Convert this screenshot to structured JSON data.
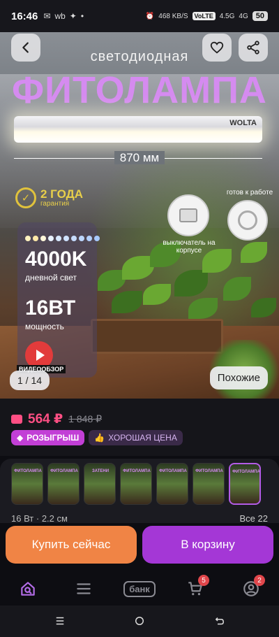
{
  "status_bar": {
    "time": "16:46",
    "network_speed": "468 KB/S",
    "volte": "VoLTE",
    "signal_1": "4.5G",
    "signal_2": "4G",
    "battery": "50"
  },
  "hero": {
    "title_small": "светодиодная",
    "title_big": "ФИТОЛАМПА",
    "lamp_brand": "WOLTA",
    "dimension": "870 мм",
    "warranty_years": "2 ГОДА",
    "warranty_sub": "гарантия",
    "spec_color_temp": "4000K",
    "spec_color_temp_sub": "дневной свет",
    "spec_power": "16ВТ",
    "spec_power_sub": "мощность",
    "switch_caption": "выключатель на корпусе",
    "socket_caption": "готов к работе",
    "video_label": "ВИДЕООБЗОР",
    "counter": "1 / 14",
    "similar_label": "Похожие",
    "dot_colors": [
      "#fff3c0",
      "#ffe9a8",
      "#fff7da",
      "#e8f2ff",
      "#d7e8ff",
      "#cfe2ff",
      "#c6dcff",
      "#bcd6ff",
      "#b2d0ff",
      "#a8caff"
    ]
  },
  "price": {
    "current": "564 ₽",
    "old": "1 848 ₽",
    "tag_raffle": "РОЗЫГРЫШ",
    "tag_good_price": "ХОРОШАЯ ЦЕНА"
  },
  "variants": {
    "thumbs": [
      "ФИТОЛАМПА",
      "ФИТОЛАМПА",
      "ЗАТЕНИ",
      "ФИТОЛАМПА",
      "ФИТОЛАМПА",
      "ФИТОЛАМПА",
      "ФИТОЛАМПА"
    ],
    "selected_info": "16 Вт · 2.2 см",
    "all_label": "Все 22"
  },
  "actions": {
    "buy_now": "Купить сейчас",
    "to_cart": "В корзину"
  },
  "bottom_nav": {
    "bank_label": "банк",
    "cart_badge": "5",
    "profile_badge": "2"
  },
  "colors": {
    "accent_pink": "#ff4f84",
    "buy_orange": "#f08445",
    "cart_purple": "#a437d6"
  }
}
